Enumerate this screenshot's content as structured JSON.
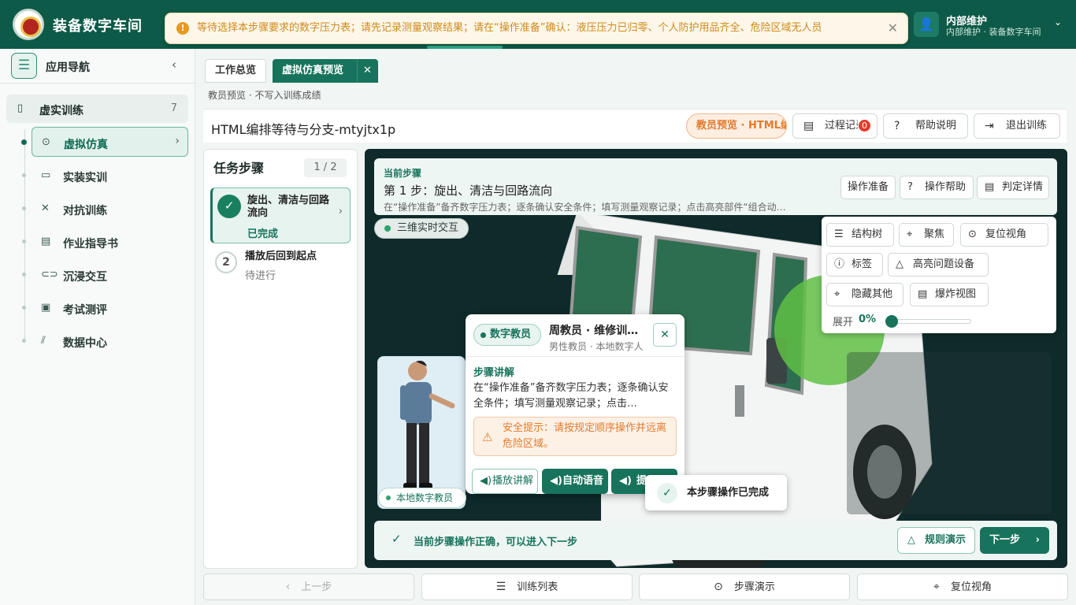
{
  "app": {
    "title": "装备数字车间"
  },
  "warning": {
    "text": "等待选择本步骤要求的数字压力表；请先记录测量观察结果；请在“操作准备”确认：液压压力已归零、个人防护用品齐全、危险区域无人员",
    "icon": "warning-icon"
  },
  "user": {
    "name": "内部维护",
    "sub": "内部维护 · 装备数字车间"
  },
  "sidebar": {
    "title": "应用导航",
    "group": {
      "label": "虚实训练",
      "count": "7"
    },
    "items": [
      {
        "label": "虚拟仿真",
        "icon": "play-circle-icon"
      },
      {
        "label": "实装实训",
        "icon": "monitor-icon"
      },
      {
        "label": "对抗训练",
        "icon": "swords-icon"
      },
      {
        "label": "作业指导书",
        "icon": "document-icon"
      },
      {
        "label": "沉浸交互",
        "icon": "vr-icon"
      },
      {
        "label": "考试测评",
        "icon": "clipboard-icon"
      },
      {
        "label": "数据中心",
        "icon": "chart-icon"
      }
    ]
  },
  "tabs": [
    {
      "label": "工作总览"
    },
    {
      "label": "虚拟仿真预览"
    }
  ],
  "breadcrumb": "教员预览 · 不写入训练成绩",
  "page": {
    "title": "HTML编排等待与分支-mtyjtx1p",
    "preview_badge": "教员预览 · HTML编排",
    "process_label": "过程记录",
    "process_count": "0",
    "help_label": "帮助说明",
    "exit_label": "退出训练"
  },
  "steps_panel": {
    "title": "任务步骤",
    "count": "1 / 2",
    "steps": [
      {
        "name": "旋出、清洁与回路流向",
        "status": "已完成"
      },
      {
        "number": "2",
        "name": "播放后回到起点",
        "status": "待进行"
      }
    ]
  },
  "current_step": {
    "label": "当前步骤",
    "title": "第 1 步：旋出、清洁与回路流向",
    "desc": "在“操作准备”备齐数字压力表；逐条确认安全条件；填写测量观察记录；点击高亮部件“组合动…",
    "buttons": [
      "操作准备",
      "操作帮助",
      "判定详情"
    ]
  },
  "viewer": {
    "mode_chip": "三维实时交互",
    "tools": [
      "结构树",
      "聚焦",
      "复位视角",
      "标签",
      "高亮问题设备",
      "隐藏其他",
      "爆炸视图"
    ],
    "expand_label": "展开",
    "expand_value": "0%",
    "expand_fraction": 0
  },
  "coach": {
    "photo_label": "本地数字教员",
    "chip": "数字教员",
    "name": "周教员 · 维修训练教员",
    "sub": "男性教员 · 本地数字人",
    "section": "步骤讲解",
    "text": "在“操作准备”备齐数字压力表；逐条确认安全条件；填写测量观察记录；点击…",
    "safety": "安全提示：请按规定顺序操作并远离危险区域。",
    "btn_play": "播放讲解",
    "btn_auto": "自动语音",
    "btn_third": "提示"
  },
  "done_toast": "本步骤操作已完成",
  "status": {
    "text": "当前步骤操作正确，可以进入下一步",
    "rule_btn": "规则演示",
    "next_btn": "下一步"
  },
  "bottom": {
    "prev": "上一步",
    "list": "训练列表",
    "demo": "步骤演示",
    "reset": "复位视角"
  },
  "colors": {
    "primary": "#17735c",
    "topbar": "#0d5a48",
    "warning": "#d08a1b",
    "alert": "#e33b2b"
  }
}
